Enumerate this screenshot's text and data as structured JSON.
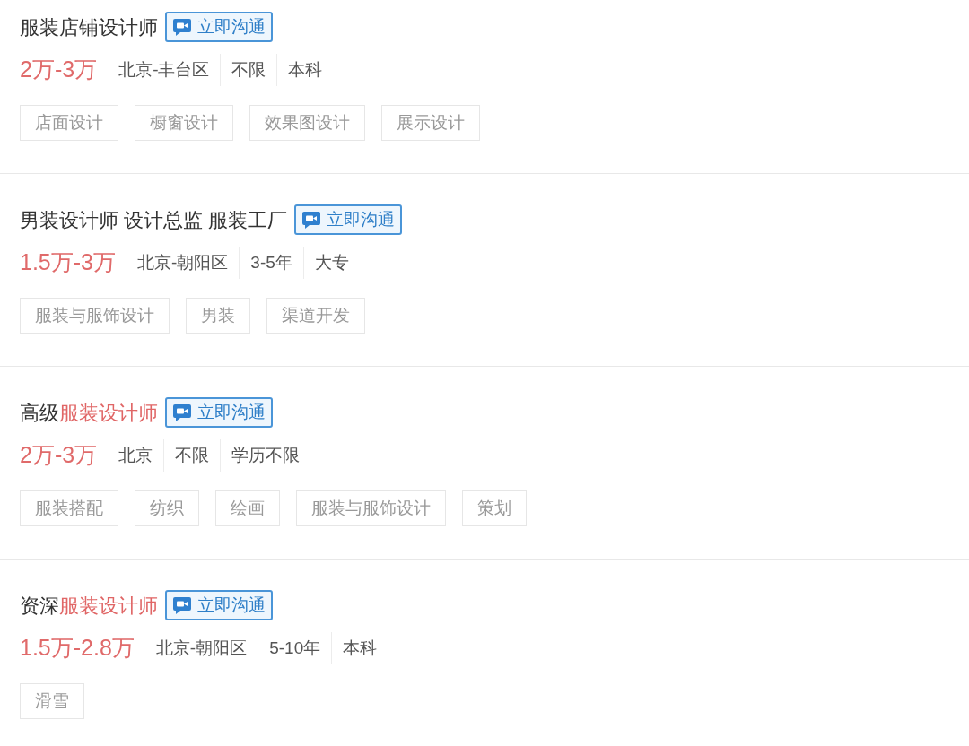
{
  "jobs": [
    {
      "title": [
        {
          "text": "服装店铺设计师",
          "highlight": false
        }
      ],
      "chat_button": "立即沟通",
      "salary": "2万-3万",
      "meta": [
        "北京-丰台区",
        "不限",
        "本科"
      ],
      "tags": [
        "店面设计",
        "橱窗设计",
        "效果图设计",
        "展示设计"
      ]
    },
    {
      "title": [
        {
          "text": "男装设计师 设计总监 服装工厂",
          "highlight": false
        }
      ],
      "chat_button": "立即沟通",
      "salary": "1.5万-3万",
      "meta": [
        "北京-朝阳区",
        "3-5年",
        "大专"
      ],
      "tags": [
        "服装与服饰设计",
        "男装",
        "渠道开发"
      ]
    },
    {
      "title": [
        {
          "text": "高级",
          "highlight": false
        },
        {
          "text": "服装设计师",
          "highlight": true
        }
      ],
      "chat_button": "立即沟通",
      "salary": "2万-3万",
      "meta": [
        "北京",
        "不限",
        "学历不限"
      ],
      "tags": [
        "服装搭配",
        "纺织",
        "绘画",
        "服装与服饰设计",
        "策划"
      ]
    },
    {
      "title": [
        {
          "text": "资深",
          "highlight": false
        },
        {
          "text": "服装设计师",
          "highlight": true
        }
      ],
      "chat_button": "立即沟通",
      "salary": "1.5万-2.8万",
      "meta": [
        "北京-朝阳区",
        "5-10年",
        "本科"
      ],
      "tags": [
        "滑雪"
      ]
    }
  ]
}
